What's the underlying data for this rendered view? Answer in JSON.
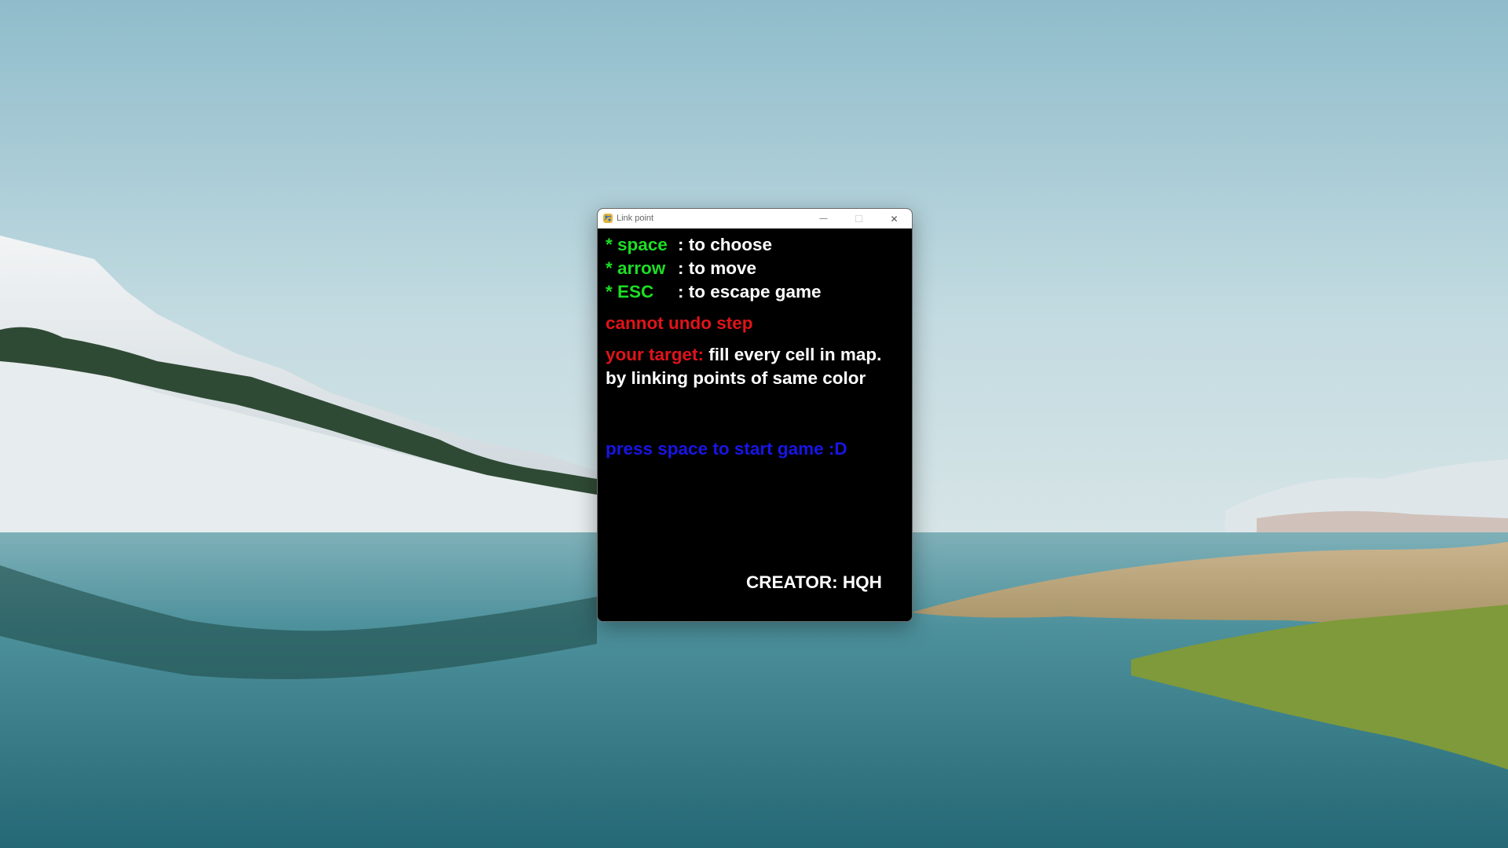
{
  "window": {
    "title": "Link point",
    "minimize_symbol": "—",
    "maximize_symbol": "☐",
    "close_symbol": "✕"
  },
  "controls": [
    {
      "key": "* space",
      "desc": ": to choose"
    },
    {
      "key": "* arrow",
      "desc": ": to move"
    },
    {
      "key": "* ESC",
      "desc": ": to escape game"
    }
  ],
  "warning": "cannot undo step",
  "target": {
    "label": "your target:",
    "text": "fill every cell in map.",
    "line2": "by linking points of same color"
  },
  "start_prompt": "press space to start game :D",
  "creator": "CREATOR: HQH",
  "colors": {
    "key": "#1dde25",
    "text": "#ffffff",
    "warning": "#e0141a",
    "prompt": "#1815e6",
    "background": "#000000"
  },
  "icons": {
    "app": "python-snake-icon",
    "minimize": "minimize-icon",
    "maximize": "maximize-icon",
    "close": "close-icon"
  }
}
